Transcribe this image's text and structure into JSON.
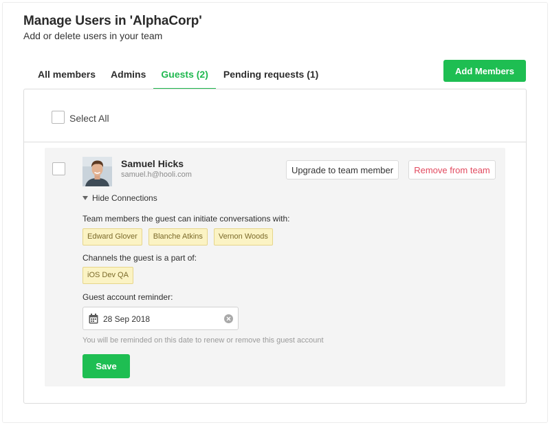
{
  "header": {
    "title": "Manage Users in 'AlphaCorp'",
    "subtitle": "Add or delete users in your team"
  },
  "tabs": [
    {
      "label": "All members",
      "active": false
    },
    {
      "label": "Admins",
      "active": false
    },
    {
      "label": "Guests (2)",
      "active": true
    },
    {
      "label": "Pending requests (1)",
      "active": false
    }
  ],
  "add_members_label": "Add Members",
  "select_all_label": "Select All",
  "member": {
    "name": "Samuel Hicks",
    "email": "samuel.h@hooli.com",
    "upgrade_label": "Upgrade to team member",
    "remove_label": "Remove from team",
    "hide_connections_label": "Hide Connections",
    "conversations_label": "Team members the guest can initiate conversations with:",
    "conversation_members": [
      "Edward Glover",
      "Blanche Atkins",
      "Vernon Woods"
    ],
    "channels_label": "Channels the guest is a part of:",
    "channels": [
      "iOS Dev QA"
    ],
    "reminder_label": "Guest account reminder:",
    "reminder_date": "28 Sep 2018",
    "reminder_note": "You will be reminded on this date to renew or remove this guest account",
    "save_label": "Save"
  },
  "colors": {
    "accent_green": "#1ebe52",
    "danger_red": "#e24a5f",
    "tag_yellow": "#fbf3c4"
  },
  "icons": [
    "triangle-down-icon",
    "calendar-icon",
    "clear-icon",
    "avatar"
  ]
}
